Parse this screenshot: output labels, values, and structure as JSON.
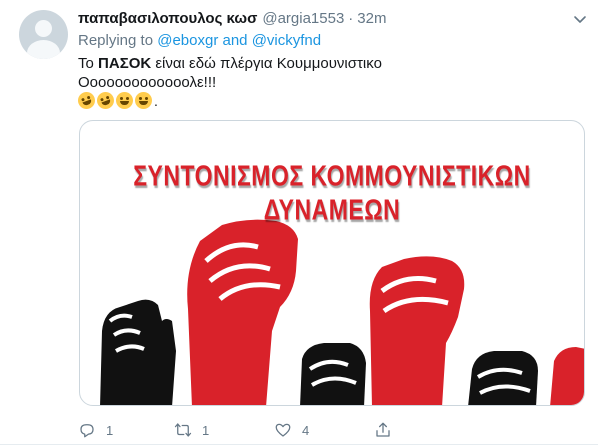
{
  "tweet": {
    "display_name": "παπαβασιλοπουλος κωσ",
    "handle": "@argia1553",
    "dot": "·",
    "time": "32m",
    "replying_to_label": "Replying to",
    "mention_1": "@eboxgr",
    "and_label": "and",
    "mention_2": "@vickyfnd",
    "text_before": "Το ",
    "text_bold": "ΠΑΣΟΚ",
    "text_after": " είναι εδώ πλέργια Κουμμουνιστικο",
    "text_line2": "Οοοοοοοοοοοοολε!!!",
    "emoji_suffix": ".",
    "emojis": [
      "rolling-on-floor-laughing",
      "rolling-on-floor-laughing",
      "winking-face-with-tongue",
      "loudly-crying-face"
    ]
  },
  "media": {
    "banner_text": "ΣΥΝΤΟΝΙΣΜΟΣ ΚΟΜΜΟΥΝΙΣΤΙΚΩΝ ΔΥΝΑΜΕΩΝ",
    "colors": {
      "red": "#d9222a",
      "black": "#111111"
    }
  },
  "actions": {
    "reply_count": "1",
    "retweet_count": "1",
    "like_count": "4",
    "share_count": ""
  },
  "colors": {
    "link": "#1b95e0",
    "secondary": "#657786",
    "primary": "#14171a"
  },
  "icons": [
    "default-avatar",
    "caret-down-icon",
    "reply-icon",
    "retweet-icon",
    "like-icon",
    "share-icon"
  ]
}
